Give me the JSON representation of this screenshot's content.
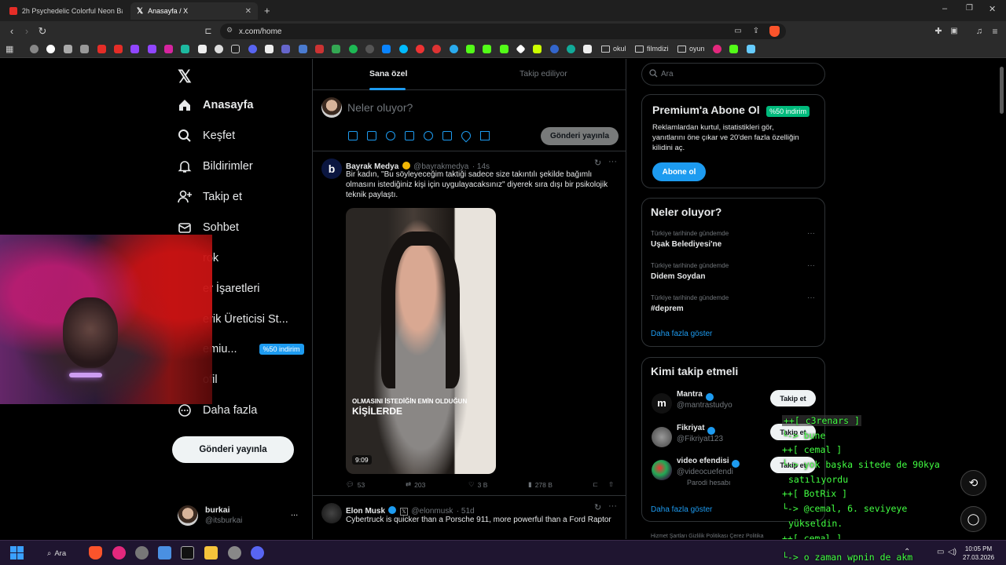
{
  "browser": {
    "tabs": [
      {
        "title": "2h Psychedelic Colorful Neon Backg",
        "favicon_color": "#e52d27",
        "active": false
      },
      {
        "title": "Anasayfa / X",
        "favicon_color": "#ffffff",
        "active": true
      }
    ],
    "new_tab_symbol": "+",
    "url": "x.com/home",
    "bookmark_folders": [
      "okul",
      "filmdizi",
      "oyun"
    ]
  },
  "sidebar": {
    "items": [
      {
        "label": "Anasayfa",
        "icon": "home-icon",
        "bold": true
      },
      {
        "label": "Keşfet",
        "icon": "search-icon"
      },
      {
        "label": "Bildirimler",
        "icon": "bell-icon"
      },
      {
        "label": "Takip et",
        "icon": "add-user-icon"
      },
      {
        "label": "Sohbet",
        "icon": "mail-icon"
      },
      {
        "label": "rok",
        "icon": "grok-icon"
      },
      {
        "label": "er İşaretleri",
        "icon": "bookmark-icon"
      },
      {
        "label": "erik Üreticisi St...",
        "icon": "creator-icon"
      },
      {
        "label": "emiu...",
        "icon": "premium-icon",
        "badge": "%50 indirim"
      },
      {
        "label": "ofil",
        "icon": "profile-icon"
      },
      {
        "label": "Daha fazla",
        "icon": "more-circle-icon"
      }
    ],
    "post_button": "Gönderi yayınla",
    "account": {
      "name": "burkai",
      "handle": "@itsburkai",
      "menu": "..."
    }
  },
  "feed": {
    "tabs": [
      "Sana özel",
      "Takip ediliyor"
    ],
    "composer_placeholder": "Neler oluyor?",
    "composer_button": "Gönderi yayınla",
    "tweets": [
      {
        "name": "Bayrak Medya",
        "handle": "@bayrakmedya",
        "time": "· 14s",
        "text_line1": "Bir kadın, \"Bu söyleyeceğim taktiği sadece size takıntılı şekilde bağımlı",
        "text_line2": "olmasını istediğiniz kişi için uygulayacaksınız\" diyerek sıra dışı bir psikolojik",
        "text_line3": "teknik paylaştı.",
        "media_caption_1": "OLMASINI İSTEDİĞİN EMİN OLDUĞUN",
        "media_caption_2": "KİŞİLERDE",
        "media_duration": "9:09",
        "replies": "53",
        "reposts": "203",
        "likes": "3 B",
        "views": "278 B"
      },
      {
        "name": "Elon Musk",
        "handle": "@elonmusk",
        "time": "· 51d",
        "text_line1": "Cybertruck is quicker than a Porsche 911, more powerful than a Ford Raptor"
      }
    ]
  },
  "right": {
    "search_placeholder": "Ara",
    "premium": {
      "title": "Premium'a Abone Ol",
      "badge": "%50 indirim",
      "desc_line1": "Reklamlardan kurtul, istatistikleri gör,",
      "desc_line2": "yanıtlarını öne çıkar ve 20'den fazla özelliğin",
      "desc_line3": "kilidini aç.",
      "button": "Abone ol"
    },
    "trends": {
      "title": "Neler oluyor?",
      "items": [
        {
          "label": "Türkiye tarihinde gündemde",
          "name": "Uşak Belediyesi'ne"
        },
        {
          "label": "Türkiye tarihinde gündemde",
          "name": "Didem Soydan"
        },
        {
          "label": "Türkiye tarihinde gündemde",
          "name": "#deprem"
        }
      ],
      "more": "Daha fazla göster"
    },
    "who_to_follow": {
      "title": "Kimi takip etmeli",
      "items": [
        {
          "name": "Mantra",
          "handle": "@mantrastudyo",
          "button": "Takip et"
        },
        {
          "name": "Fikriyat",
          "handle": "@Fikriyat123",
          "button": "Takip et"
        },
        {
          "name": "video efendisi",
          "handle": "@videocuefendi",
          "sub": "Parodi hesabı",
          "button": "Takip et"
        }
      ],
      "more": "Daha fazla göster"
    },
    "footer": "Hizmet Şartları  Gizlilik Politikası  Çerez Politika"
  },
  "chat_overlay": {
    "lines": [
      "++[ c3renars ]",
      "└-> bune",
      "++[ cemal ]",
      "└-> yok başka sitede de 90kya",
      "satılıyordu",
      "++[ BotRix ]",
      "└-> @cemal, 6. seviyeye",
      "yükseldin.",
      "++[ cemal ]",
      "└-> o zaman wpnin de akm"
    ]
  },
  "taskbar": {
    "search_label": "Ara",
    "time": "10:05 PM",
    "date": "27.03.2026"
  }
}
